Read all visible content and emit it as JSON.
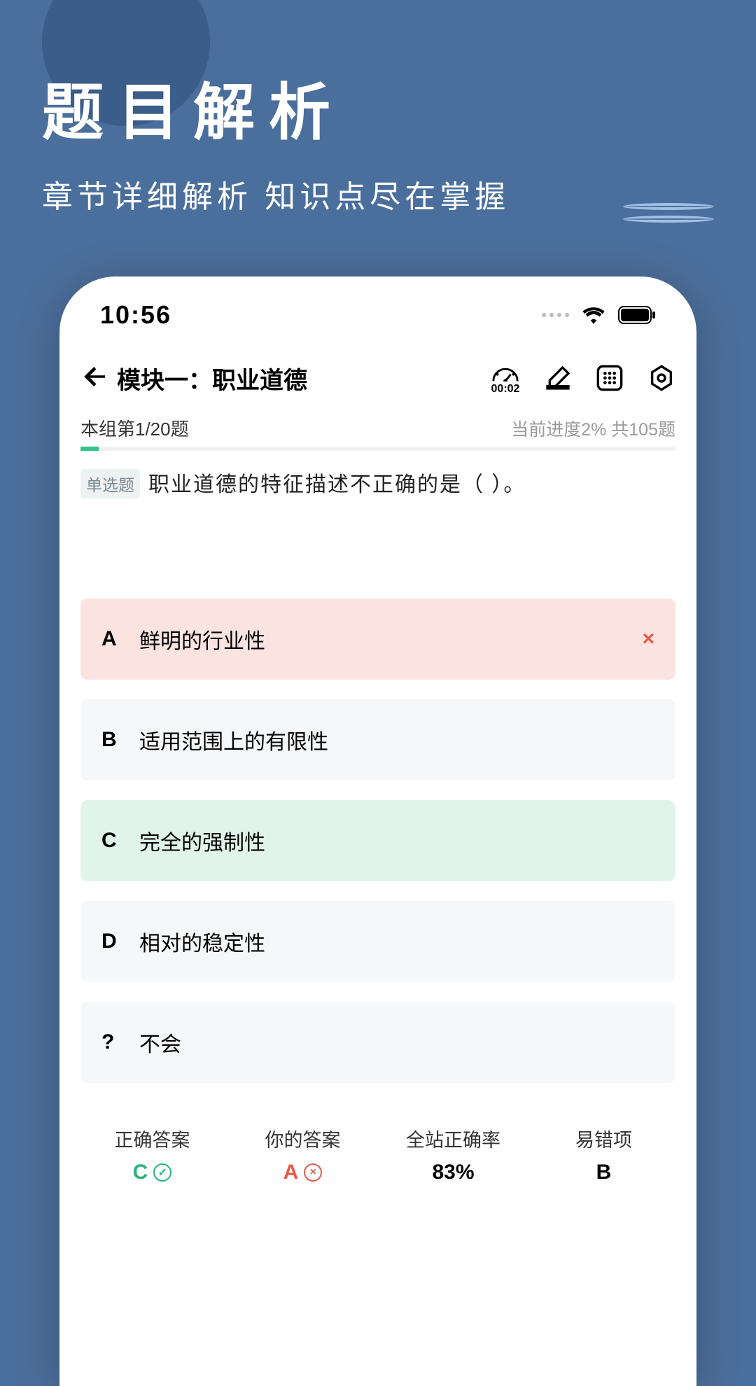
{
  "hero": {
    "title": "题目解析",
    "subtitle": "章节详细解析  知识点尽在掌握"
  },
  "statusbar": {
    "time": "10:56"
  },
  "appbar": {
    "title": "模块一：职业道德",
    "timer": "00:02"
  },
  "progress": {
    "left": "本组第1/20题",
    "right": "当前进度2%  共105题",
    "percent": 2
  },
  "question": {
    "tag": "单选题",
    "text": "职业道德的特征描述不正确的是（ ）。"
  },
  "options": [
    {
      "letter": "A",
      "text": "鲜明的行业性",
      "state": "wrong",
      "mark": "×"
    },
    {
      "letter": "B",
      "text": "适用范围上的有限性",
      "state": "normal",
      "mark": ""
    },
    {
      "letter": "C",
      "text": "完全的强制性",
      "state": "correct",
      "mark": ""
    },
    {
      "letter": "D",
      "text": "相对的稳定性",
      "state": "normal",
      "mark": ""
    },
    {
      "letter": "?",
      "text": "不会",
      "state": "normal",
      "mark": ""
    }
  ],
  "answer": {
    "correct_label": "正确答案",
    "correct_value": "C",
    "your_label": "你的答案",
    "your_value": "A",
    "site_label": "全站正确率",
    "site_value": "83%",
    "confuse_label": "易错项",
    "confuse_value": "B"
  }
}
